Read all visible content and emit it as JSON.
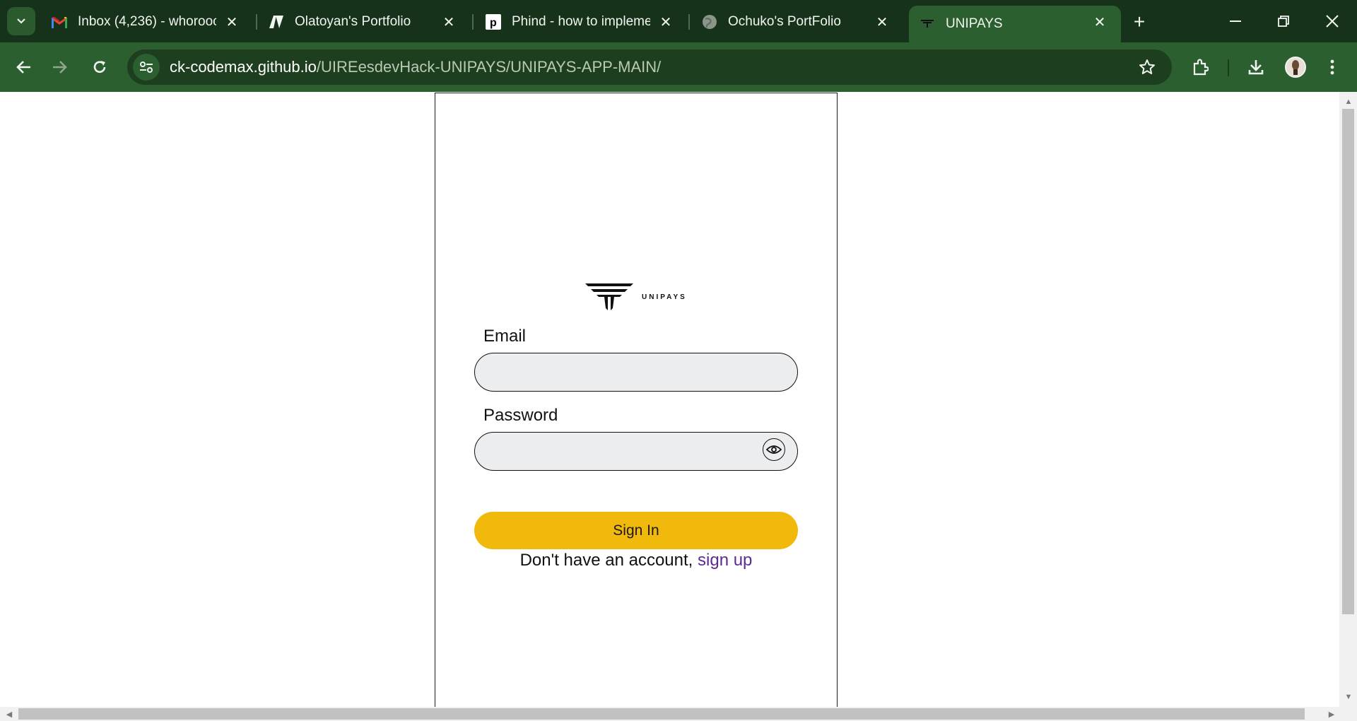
{
  "browser": {
    "tabs": [
      {
        "title": "Inbox (4,236) - whoroocho",
        "favicon": "gmail-icon"
      },
      {
        "title": "Olatoyan's Portfolio",
        "favicon": "portfolio-logo-icon"
      },
      {
        "title": "Phind - how to implemen",
        "favicon": "phind-icon"
      },
      {
        "title": "Ochuko's PortFolio",
        "favicon": "globe-icon"
      },
      {
        "title": "UNIPAYS",
        "favicon": "unipays-icon"
      }
    ],
    "active_tab_index": 4,
    "url": {
      "domain": "ck-codemax.github.io",
      "path": "/UIREesdevHack-UNIPAYS/UNIPAYS-APP-MAIN/"
    },
    "colors": {
      "tabstrip": "#17321a",
      "toolbar": "#2c5f2f",
      "omnibox": "#1d3f1f"
    }
  },
  "app": {
    "logo_text": "UNIPAYS",
    "email_label": "Email",
    "email_value": "",
    "password_label": "Password",
    "password_value": "",
    "signin_label": "Sign In",
    "signup_prompt": "Don't have an account, ",
    "signup_link": "sign up",
    "colors": {
      "button": "#f0b90b",
      "input_bg": "#ecedef",
      "link": "#5b2c92"
    }
  }
}
